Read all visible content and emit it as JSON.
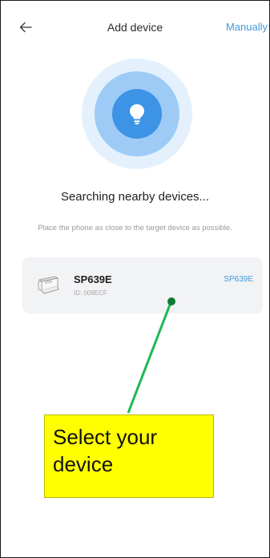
{
  "header": {
    "title": "Add device",
    "manual_label": "Manually"
  },
  "search": {
    "status_text": "Searching nearby devices...",
    "hint_text": "Place the phone as close to the target device as possible."
  },
  "device": {
    "name": "SP639E",
    "id_text": "ID: 008ECF",
    "model_tag": "SP639E"
  },
  "annotation": {
    "callout_text": "Select your device"
  },
  "colors": {
    "accent": "#3e9bdc",
    "radar_outer": "#e4f1fd",
    "radar_mid": "#9dcbf6",
    "radar_core": "#3d93e5",
    "card_bg": "#f2f3f5",
    "callout_bg": "#ffff00",
    "pointer_line": "#1db954",
    "pointer_dot": "#0e7a36"
  },
  "icons": {
    "back": "arrow-left-icon",
    "bulb": "lightbulb-icon",
    "device": "printer-icon"
  }
}
